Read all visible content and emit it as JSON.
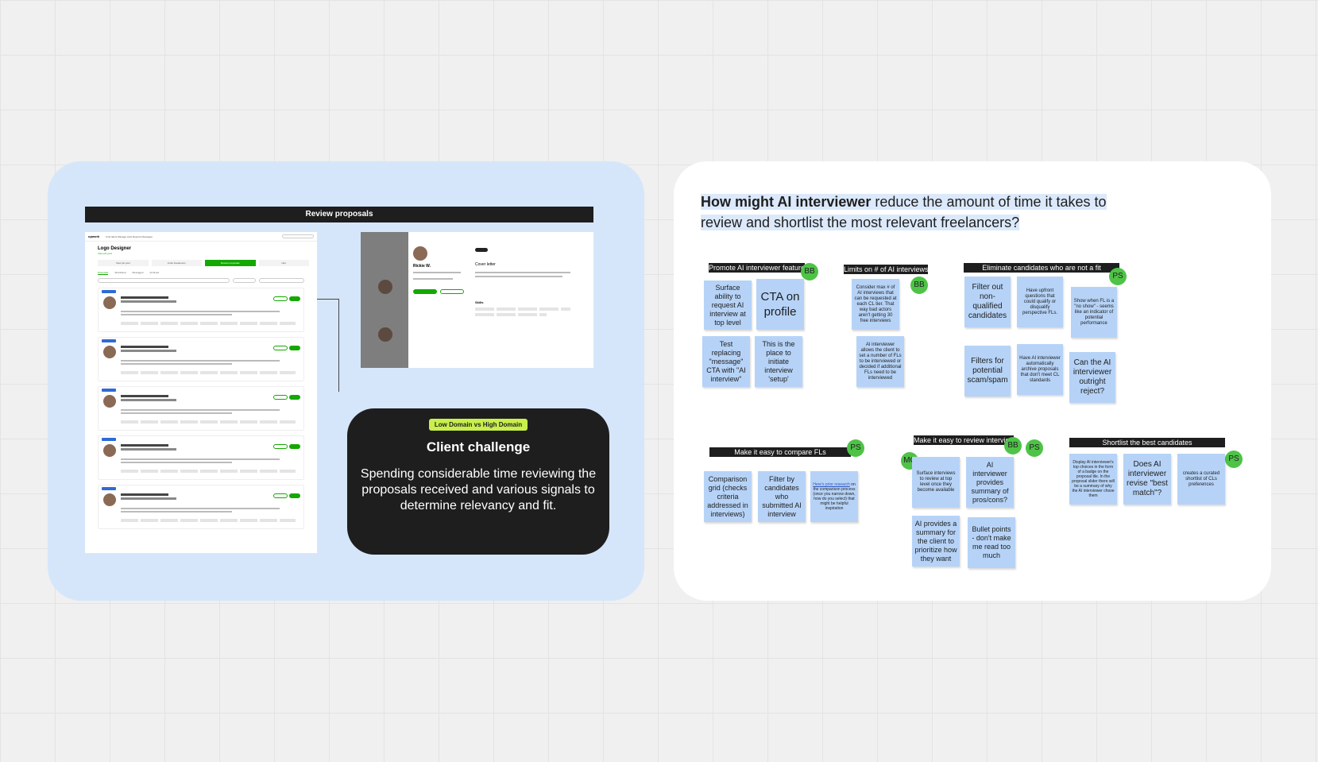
{
  "left_panel": {
    "review_bar": "Review proposals",
    "screenshot_list": {
      "logo": "upwork",
      "nav": "Find talent  Manage work  Reports  Messages",
      "job_title": "Logo Designer",
      "job_sub": "View job post",
      "steps": [
        "View job post",
        "Invite freelancers",
        "Review proposals",
        "Hire"
      ],
      "tabs": [
        "Proposals",
        "Shortlisted",
        "Messaged",
        "Archived"
      ]
    },
    "screenshot_profile": {
      "name": "Rickie W.",
      "cover_heading": "Cover letter",
      "skills_heading": "Skills"
    },
    "challenge": {
      "badge": "Low Domain vs High Domain",
      "title": "Client challenge",
      "body": "Spending considerable time reviewing the proposals received and various signals to determine relevancy and fit."
    }
  },
  "right_panel": {
    "hmw_bold": "How might AI interviewer",
    "hmw_rest": " reduce the amount of time it takes to review and shortlist the most relevant freelancers?",
    "clusters": {
      "promote": {
        "label": "Promote AI interviewer feature",
        "avatar": "BB",
        "notes": [
          "Surface ability to request AI interview at top level",
          "CTA on profile",
          "Test replacing \"message\" CTA with \"AI interview\"",
          "This is the place to initiate interview 'setup'"
        ]
      },
      "limits": {
        "label": "Limits on # of AI interviews",
        "avatar": "BB",
        "notes": [
          "Consider max # of AI interviews that can be requested at each CL tier. That way bad actors aren't getting 30 free interviews",
          "AI interviewer allows the client to set a number of FLs to be interviewed or decided if additional FLs need to be interviewed"
        ]
      },
      "eliminate": {
        "label": "Eliminate candidates who are not a fit",
        "avatar": "PS",
        "notes": [
          "Filter out non-qualified candidates",
          "Have upfront questions that could qualify or disqualify perspective FLs.",
          "Show when FL is a \"no show\" - seems like an indicator of potential performance",
          "Filters for potential scam/spam",
          "Have AI interviewer automatically archive proposals that don't meet CL standards",
          "Can the AI interviewer outright reject?"
        ]
      },
      "compare": {
        "label": "Make it easy to compare FLs",
        "avatar": "PS",
        "notes": [
          "Comparison grid (checks criteria addressed in interviews)",
          "Filter by candidates who submitted AI interview",
          "Here's prior research",
          " on the comparison process (once you narrow down, how do you select) that might be helpful inspiration"
        ]
      },
      "review": {
        "label": "Make it easy to review interviews",
        "avatars": [
          "BB",
          "PS",
          "MC"
        ],
        "notes": [
          "Surface interviews to review at top level once they become available",
          "AI interviewer provides summary of pros/cons?",
          "AI provides a summary for the client to prioritize how they want",
          "Bullet points - don't make me read too much"
        ]
      },
      "shortlist": {
        "label": "Shortlist the best candidates",
        "avatar": "PS",
        "notes": [
          "Display AI interviewer's top choices in the form of a badge on the proposal tile. In the proposal slider there will be a summary of why the AI interviewer chose them",
          "Does AI interviewer revise \"best match\"?",
          "creates a curated shortlist of CLs preferences"
        ]
      }
    }
  }
}
